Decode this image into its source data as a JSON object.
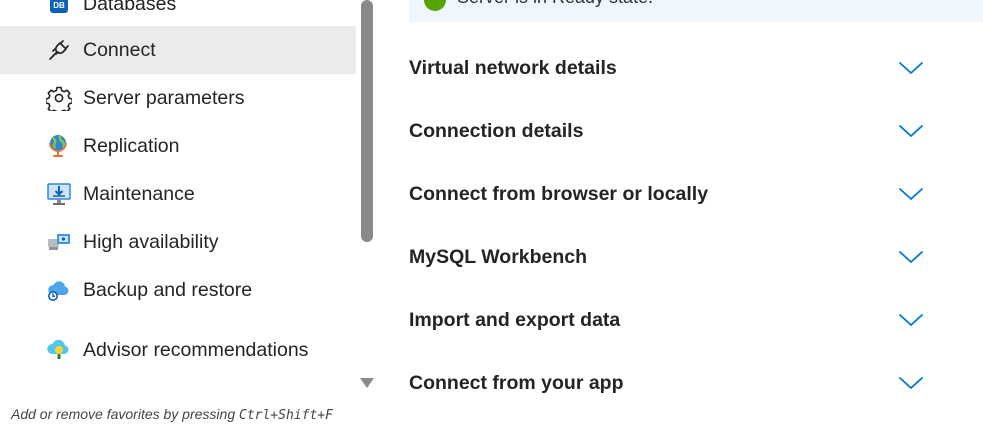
{
  "sidebar": {
    "items": [
      {
        "label": "Databases",
        "icon": "database-icon",
        "active": false
      },
      {
        "label": "Connect",
        "icon": "plug-icon",
        "active": true
      },
      {
        "label": "Server parameters",
        "icon": "gear-icon",
        "active": false
      },
      {
        "label": "Replication",
        "icon": "globe-icon",
        "active": false
      },
      {
        "label": "Maintenance",
        "icon": "monitor-download-icon",
        "active": false
      },
      {
        "label": "High availability",
        "icon": "servers-icon",
        "active": false
      },
      {
        "label": "Backup and restore",
        "icon": "cloud-backup-icon",
        "active": false
      },
      {
        "label": "Advisor recommendations",
        "icon": "cloud-lightbulb-icon",
        "active": false
      }
    ],
    "db_badge": "DB",
    "footer_hint_prefix": "Add or remove favorites by pressing ",
    "footer_hint_keys": "Ctrl+Shift+F"
  },
  "main": {
    "status_text": "Server is in Ready state.",
    "sections": [
      {
        "title": "Virtual network details"
      },
      {
        "title": "Connection details"
      },
      {
        "title": "Connect from browser or locally"
      },
      {
        "title": "MySQL Workbench"
      },
      {
        "title": "Import and export data"
      },
      {
        "title": "Connect from your app"
      }
    ]
  },
  "colors": {
    "active_bg": "#ebebeb",
    "accent_blue": "#0078d4",
    "status_bg": "#eff6fc",
    "status_ok": "#57a300"
  }
}
